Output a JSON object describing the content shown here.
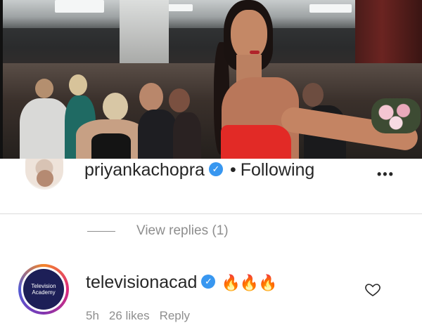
{
  "post_image": {
    "alt_icon": "photo-image"
  },
  "top_comment": {
    "username": "priyankachopra",
    "verified_icon": "verified-badge-icon",
    "separator": "•",
    "follow_status": "Following",
    "more_icon": "more-options-icon",
    "more_label": "•••"
  },
  "replies": {
    "label": "View replies (1)"
  },
  "bottom_comment": {
    "username": "televisionacad",
    "verified_icon": "verified-badge-icon",
    "text": "🔥🔥🔥",
    "avatar_text_line1": "Television",
    "avatar_text_line2": "Academy",
    "like_icon": "heart-icon",
    "meta": {
      "time": "5h",
      "likes": "26 likes",
      "reply": "Reply"
    }
  },
  "colors": {
    "accent": "#3897f0",
    "text": "#262626",
    "muted": "#8e8e8e",
    "divider": "#dbdbdb",
    "dress_red": "#e22a26"
  }
}
